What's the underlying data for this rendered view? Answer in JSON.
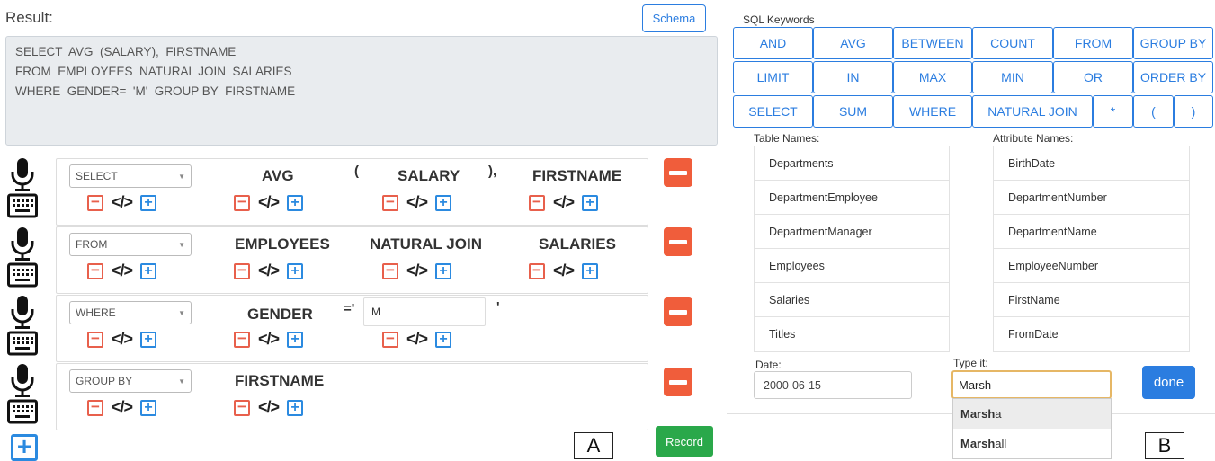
{
  "panel_a": {
    "result_label": "Result:",
    "schema_button": "Schema",
    "query_lines": [
      "SELECT  AVG  (SALARY),  FIRSTNAME",
      "FROM  EMPLOYEES  NATURAL JOIN  SALARIES",
      "WHERE  GENDER=  'M'  GROUP BY  FIRSTNAME"
    ],
    "rows": [
      {
        "keyword": "SELECT",
        "items": [
          "AVG",
          "SALARY",
          "FIRSTNAME"
        ],
        "punct": [
          "(",
          "),"
        ]
      },
      {
        "keyword": "FROM",
        "items": [
          "EMPLOYEES",
          "NATURAL JOIN",
          "SALARIES"
        ]
      },
      {
        "keyword": "WHERE",
        "items": [
          "GENDER"
        ],
        "punct": [
          "='",
          "'"
        ],
        "value": "M"
      },
      {
        "keyword": "GROUP BY",
        "items": [
          "FIRSTNAME"
        ]
      }
    ],
    "record_button": "Record",
    "panel_letter": "A"
  },
  "panel_b": {
    "sql_keywords_label": "SQL Keywords",
    "keywords": [
      "AND",
      "AVG",
      "BETWEEN",
      "COUNT",
      "FROM",
      "GROUP BY",
      "LIMIT",
      "IN",
      "MAX",
      "MIN",
      "OR",
      "ORDER BY",
      "SELECT",
      "SUM",
      "WHERE",
      "NATURAL JOIN",
      "*",
      "(",
      ")"
    ],
    "table_names_label": "Table Names:",
    "table_names": [
      "Departments",
      "DepartmentEmployee",
      "DepartmentManager",
      "Employees",
      "Salaries",
      "Titles"
    ],
    "attribute_names_label": "Attribute Names:",
    "attribute_names": [
      "BirthDate",
      "DepartmentNumber",
      "DepartmentName",
      "EmployeeNumber",
      "FirstName",
      "FromDate"
    ],
    "date_label": "Date:",
    "date_value": "2000-06-15",
    "type_label": "Type it:",
    "type_value": "Marsh",
    "done_button": "done",
    "suggestions": [
      {
        "match": "Marsh",
        "rest": "a"
      },
      {
        "match": "Marsh",
        "rest": "all"
      }
    ],
    "panel_letter": "B"
  },
  "colors": {
    "accent_blue": "#2b7de0",
    "delete_red": "#f05d3b",
    "record_green": "#2aa84a",
    "focus_orange": "#e6b765"
  }
}
